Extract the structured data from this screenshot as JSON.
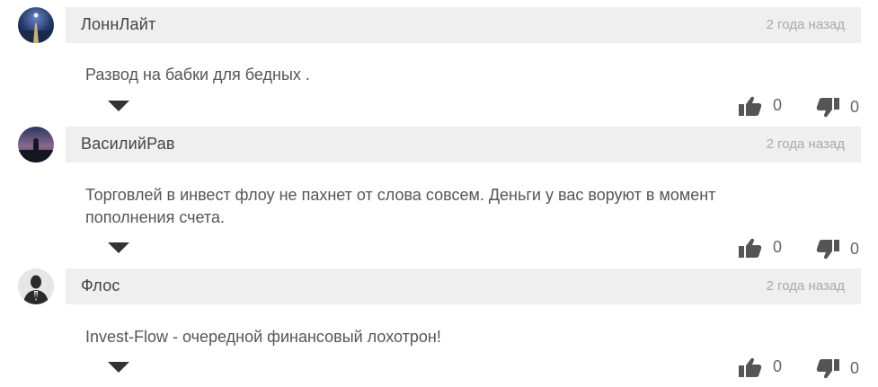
{
  "comments": [
    {
      "author": "ЛоннЛайт",
      "time": "2 года назад",
      "text": "Развод на бабки для бедных .",
      "likes": "0",
      "dislikes": "0",
      "avatar": "night-pier-avatar"
    },
    {
      "author": "ВасилийРав",
      "time": "2 года назад",
      "text": "Торговлей в инвест флоу не пахнет от слова совсем. Деньги у вас воруют в момент пополнения счета.",
      "likes": "0",
      "dislikes": "0",
      "avatar": "dusk-silhouette-avatar"
    },
    {
      "author": "Флос",
      "time": "2 года назад",
      "text": "Invest-Flow - очередной финансовый лохотрон!",
      "likes": "0",
      "dislikes": "0",
      "avatar": "default-user-avatar"
    }
  ],
  "icons": {
    "like": "thumbs-up-icon",
    "dislike": "thumbs-down-icon",
    "expand": "caret-down-icon"
  },
  "colors": {
    "header_bg": "#efefef",
    "icon": "#555555",
    "meta": "#a9a9a9"
  }
}
